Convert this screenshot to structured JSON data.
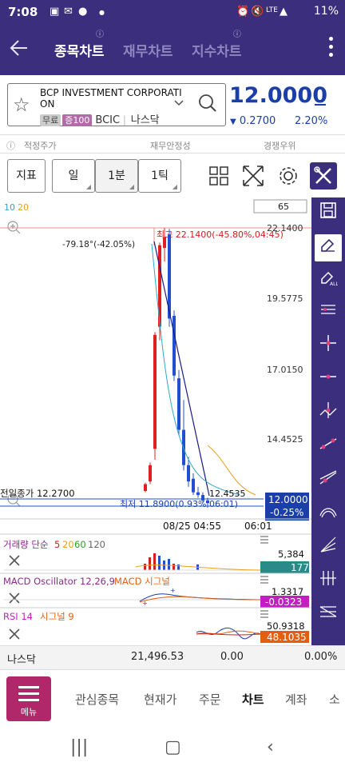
{
  "status_bar": {
    "time": "7:08",
    "right": "11%",
    "lte": "LTE"
  },
  "app_bar": {
    "tabs": [
      {
        "label": "종목차트",
        "active": true
      },
      {
        "label": "재무차트",
        "active": false
      },
      {
        "label": "지수차트",
        "active": false
      }
    ]
  },
  "stock": {
    "name": "BCP INVESTMENT CORPORATION",
    "name_line1": "BCP INVESTMENT CORPORATI",
    "name_line2": "ON",
    "badge_free": "무료",
    "badge_margin": "증100",
    "ticker": "BCIC",
    "exchange": "나스닥",
    "price": "12.0000",
    "change": "0.2700",
    "change_rate": "2.20%",
    "change_direction": "down",
    "color_down": "#1a3fa8"
  },
  "info_tabs": {
    "fair_price": "적정주가",
    "financial": "재무안정성",
    "competition": "경쟁우위"
  },
  "controls": {
    "indicator_label": "지표",
    "day_label": "일",
    "minute_label": "1분",
    "tick_label": "1틱",
    "icons": [
      "grid-icon",
      "expand-icon",
      "settings-icon",
      "tools-icon"
    ]
  },
  "chart": {
    "ma_labels": [
      "10",
      "20"
    ],
    "count_box": "65",
    "y_ticks": [
      "22.1400",
      "19.5775",
      "17.0150",
      "14.4525"
    ],
    "high_label": "최고 22.1400(-45.80%,04:45)",
    "angle_label": "-79.18°(-42.05%)",
    "prev_close_label": "전일종가 12.2700",
    "low_label": "최저 11.8900(0.93%,06:01)",
    "last_label": "12.4535",
    "current_box_price": "12.0000",
    "current_box_rate": "-0.25%",
    "x_labels": [
      "08/25 04:55",
      "06:01"
    ],
    "colors": {
      "up": "#e02020",
      "down": "#2050d0",
      "ma10": "#2aa8c8",
      "ma20": "#e8a020",
      "trend": "#1a1a8a"
    }
  },
  "chart_data": {
    "type": "candlestick",
    "title": "",
    "ylim": [
      11.5,
      22.6
    ],
    "high": 22.14,
    "low": 11.89,
    "prev_close": 12.27,
    "current": 12.0,
    "candles": [
      {
        "o": 12.45,
        "h": 12.75,
        "l": 12.4,
        "c": 12.7
      },
      {
        "o": 12.8,
        "h": 13.5,
        "l": 12.7,
        "c": 13.4
      },
      {
        "o": 14.0,
        "h": 18.3,
        "l": 13.6,
        "c": 18.2
      },
      {
        "o": 18.5,
        "h": 21.6,
        "l": 18.0,
        "c": 21.5
      },
      {
        "o": 21.4,
        "h": 22.14,
        "l": 20.9,
        "c": 21.8
      },
      {
        "o": 21.9,
        "h": 22.1,
        "l": 18.5,
        "c": 18.8
      },
      {
        "o": 18.9,
        "h": 19.1,
        "l": 16.5,
        "c": 16.7
      },
      {
        "o": 16.6,
        "h": 16.9,
        "l": 14.5,
        "c": 14.7
      },
      {
        "o": 14.7,
        "h": 15.8,
        "l": 13.2,
        "c": 13.4
      },
      {
        "o": 13.4,
        "h": 13.7,
        "l": 12.6,
        "c": 12.8
      },
      {
        "o": 12.9,
        "h": 13.1,
        "l": 12.3,
        "c": 12.4
      },
      {
        "o": 12.4,
        "h": 12.6,
        "l": 12.2,
        "c": 12.3
      },
      {
        "o": 12.3,
        "h": 12.4,
        "l": 12.0,
        "c": 12.1
      },
      {
        "o": 12.1,
        "h": 12.2,
        "l": 11.89,
        "c": 12.0
      }
    ]
  },
  "sub_panels": {
    "volume": {
      "label_pre": "거래량 단순",
      "p5": "5",
      "p20": "20",
      "p60": "60",
      "p120": "120",
      "tick": "5,384",
      "value": "177"
    },
    "macd": {
      "label_a": "MACD Oscillator 12,26,9",
      "label_b": "MACD 시그널",
      "tick": "1.3317",
      "value": "-0.0323"
    },
    "rsi": {
      "label_a": "RSI 14",
      "label_b": "시그널 9",
      "tick": "50.9318",
      "value": "48.1035"
    }
  },
  "summary": {
    "exchange": "나스닥",
    "index": "21,496.53",
    "change": "0.00",
    "rate": "0.00%"
  },
  "bottom_nav": {
    "menu_label": "메뉴",
    "items": [
      "관심종목",
      "현재가",
      "주문",
      "차트",
      "계좌",
      "소"
    ]
  }
}
